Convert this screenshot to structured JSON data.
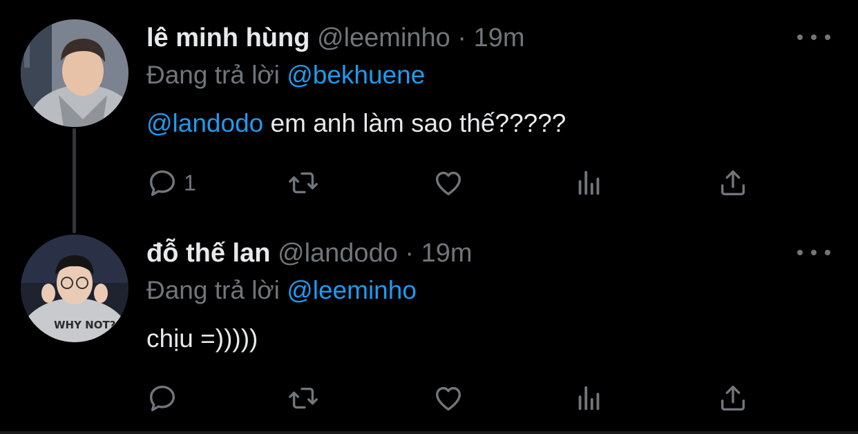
{
  "tweets": [
    {
      "name": "lê minh hùng",
      "handle": "@leeminho",
      "separator": "·",
      "time": "19m",
      "reply_prefix": "Đang trả lời",
      "reply_to": "@bekhuene",
      "mention": "@landodo",
      "text": " em anh làm sao thế?????",
      "reply_count": "1",
      "avatar": "avatar-photo"
    },
    {
      "name": "đỗ thế lan",
      "handle": "@landodo",
      "separator": "·",
      "time": "19m",
      "reply_prefix": "Đang trả lời",
      "reply_to": "@leeminho",
      "text": "chịu =)))))",
      "reply_count": "",
      "avatar": "avatar-photo"
    }
  ],
  "icons": [
    "reply-icon",
    "retweet-icon",
    "like-icon",
    "views-icon",
    "share-icon",
    "more-icon"
  ],
  "colors": {
    "background": "#000000",
    "text": "#e7e9ea",
    "muted": "#71767b",
    "accent": "#1d9bf0"
  }
}
